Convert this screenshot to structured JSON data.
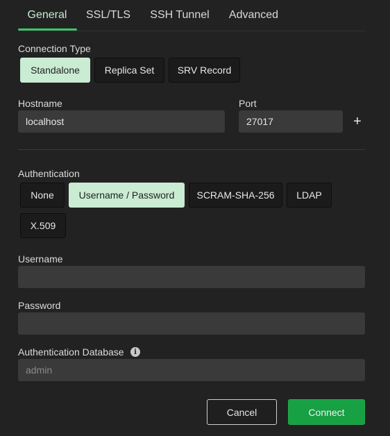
{
  "tabs": [
    {
      "label": "General",
      "active": true
    },
    {
      "label": "SSL/TLS",
      "active": false
    },
    {
      "label": "SSH Tunnel",
      "active": false
    },
    {
      "label": "Advanced",
      "active": false
    }
  ],
  "connection_type": {
    "label": "Connection Type",
    "options": [
      "Standalone",
      "Replica Set",
      "SRV Record"
    ],
    "selected": "Standalone"
  },
  "hostname": {
    "label": "Hostname",
    "value": "localhost"
  },
  "port": {
    "label": "Port",
    "value": "27017"
  },
  "add_host_icon": "plus-icon",
  "authentication": {
    "label": "Authentication",
    "options": [
      "None",
      "Username / Password",
      "SCRAM-SHA-256",
      "LDAP",
      "X.509"
    ],
    "selected": "Username / Password"
  },
  "username": {
    "label": "Username",
    "value": ""
  },
  "password": {
    "label": "Password",
    "value": ""
  },
  "auth_database": {
    "label": "Authentication Database",
    "value": "",
    "placeholder": "admin",
    "info_icon": "info-icon"
  },
  "buttons": {
    "cancel": "Cancel",
    "connect": "Connect"
  },
  "colors": {
    "accent": "#3cc66a",
    "selected_bg": "#c9ecd2",
    "connect_bg": "#17a044"
  }
}
